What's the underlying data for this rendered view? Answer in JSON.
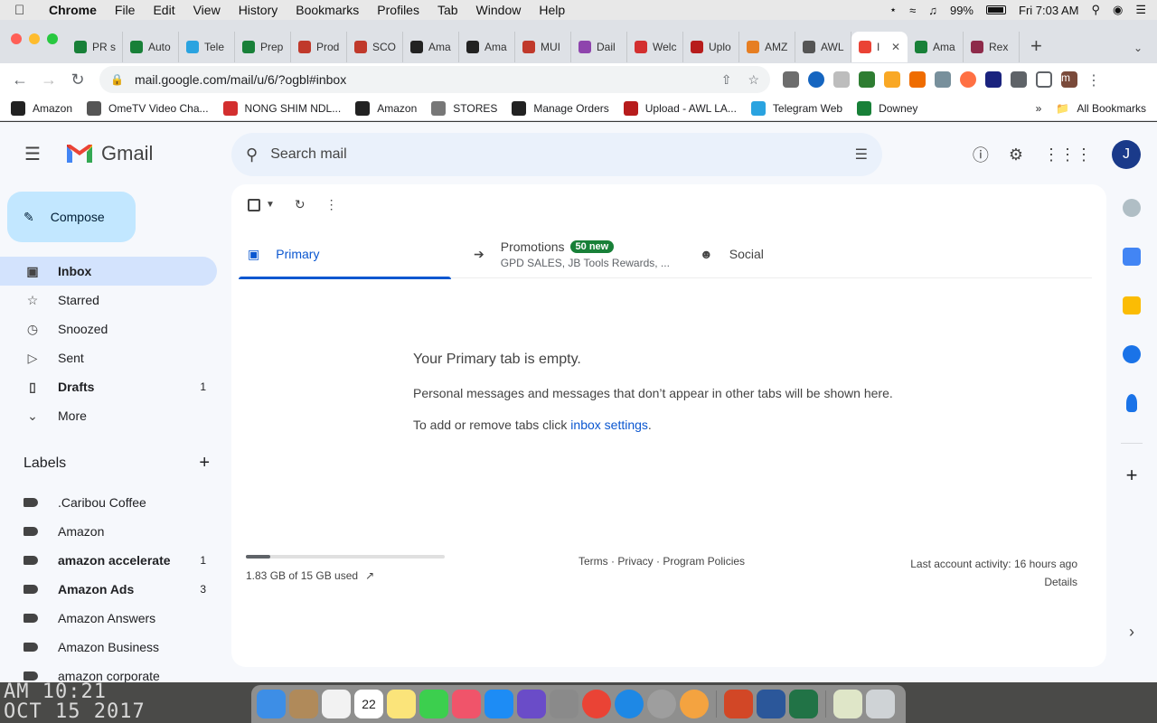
{
  "menubar": {
    "app": "Chrome",
    "items": [
      "File",
      "Edit",
      "View",
      "History",
      "Bookmarks",
      "Profiles",
      "Tab",
      "Window",
      "Help"
    ],
    "battery": "99%",
    "clock": "Fri 7:03 AM"
  },
  "tabs": [
    {
      "label": "PR s",
      "color": "#188038"
    },
    {
      "label": "Auto",
      "color": "#188038"
    },
    {
      "label": "Tele",
      "color": "#2aa3e0"
    },
    {
      "label": "Prep",
      "color": "#188038"
    },
    {
      "label": "Prod",
      "color": "#c0392b"
    },
    {
      "label": "SCO",
      "color": "#c0392b"
    },
    {
      "label": "Ama",
      "color": "#222222"
    },
    {
      "label": "Ama",
      "color": "#222222"
    },
    {
      "label": "MUI",
      "color": "#c0392b"
    },
    {
      "label": "Dail",
      "color": "#8e44ad"
    },
    {
      "label": "Welc",
      "color": "#d32f2f"
    },
    {
      "label": "Uplo",
      "color": "#b71c1c"
    },
    {
      "label": "AMZ",
      "color": "#e67e22"
    },
    {
      "label": "AWL",
      "color": "#555555"
    },
    {
      "label": "I",
      "color": "#ea4335",
      "active": true
    },
    {
      "label": "Ama",
      "color": "#188038"
    },
    {
      "label": "Rex",
      "color": "#8e2a4a"
    }
  ],
  "address": {
    "url": "mail.google.com/mail/u/6/?ogbl#inbox"
  },
  "bookmarks": [
    {
      "label": "Amazon",
      "color": "#222222"
    },
    {
      "label": "OmeTV Video Cha...",
      "color": "#555555"
    },
    {
      "label": "NONG SHIM NDL...",
      "color": "#d32f2f"
    },
    {
      "label": "Amazon",
      "color": "#222222"
    },
    {
      "label": "STORES",
      "color": "#777777"
    },
    {
      "label": "Manage Orders",
      "color": "#222222"
    },
    {
      "label": "Upload - AWL LA...",
      "color": "#b71c1c"
    },
    {
      "label": "Telegram Web",
      "color": "#2aa3e0"
    },
    {
      "label": "Downey",
      "color": "#188038"
    }
  ],
  "bookmarks_more": "»",
  "all_bookmarks": "All Bookmarks",
  "profile_initial": "m",
  "gmail": {
    "brand": "Gmail",
    "search_placeholder": "Search mail",
    "avatar": "J",
    "compose": "Compose",
    "nav": [
      {
        "label": "Inbox",
        "icon": "inbox-icon",
        "active": true,
        "count": ""
      },
      {
        "label": "Starred",
        "icon": "star-icon",
        "count": ""
      },
      {
        "label": "Snoozed",
        "icon": "clock-icon",
        "count": ""
      },
      {
        "label": "Sent",
        "icon": "send-icon",
        "count": ""
      },
      {
        "label": "Drafts",
        "icon": "draft-icon",
        "bold": true,
        "count": "1"
      },
      {
        "label": "More",
        "icon": "chevron-down-icon",
        "count": ""
      }
    ],
    "labels_title": "Labels",
    "labels": [
      {
        "label": ".Caribou Coffee",
        "count": ""
      },
      {
        "label": "Amazon",
        "count": ""
      },
      {
        "label": "amazon accelerate",
        "count": "1",
        "bold": true
      },
      {
        "label": "Amazon Ads",
        "count": "3",
        "bold": true
      },
      {
        "label": "Amazon Answers",
        "count": ""
      },
      {
        "label": "Amazon Business",
        "count": ""
      },
      {
        "label": "amazon corporate",
        "count": ""
      }
    ],
    "tabs": [
      {
        "label": "Primary",
        "active": true
      },
      {
        "label": "Promotions",
        "badge": "50 new",
        "sub": "GPD SALES, JB Tools Rewards, ..."
      },
      {
        "label": "Social"
      }
    ],
    "empty": {
      "heading": "Your Primary tab is empty.",
      "body": "Personal messages and messages that don’t appear in other tabs will be shown here.",
      "settings_prefix": "To add or remove tabs click ",
      "settings_link": "inbox settings",
      "settings_suffix": "."
    },
    "footer": {
      "storage_used_fraction": 0.122,
      "storage_text": "1.83 GB of 15 GB used",
      "links": "Terms · Privacy · Program Policies",
      "activity": "Last account activity: 16 hours ago",
      "details": "Details"
    }
  },
  "wallpaper_text": [
    "AM 10:21",
    "OCT 15 2017"
  ],
  "calendar_day": "22"
}
